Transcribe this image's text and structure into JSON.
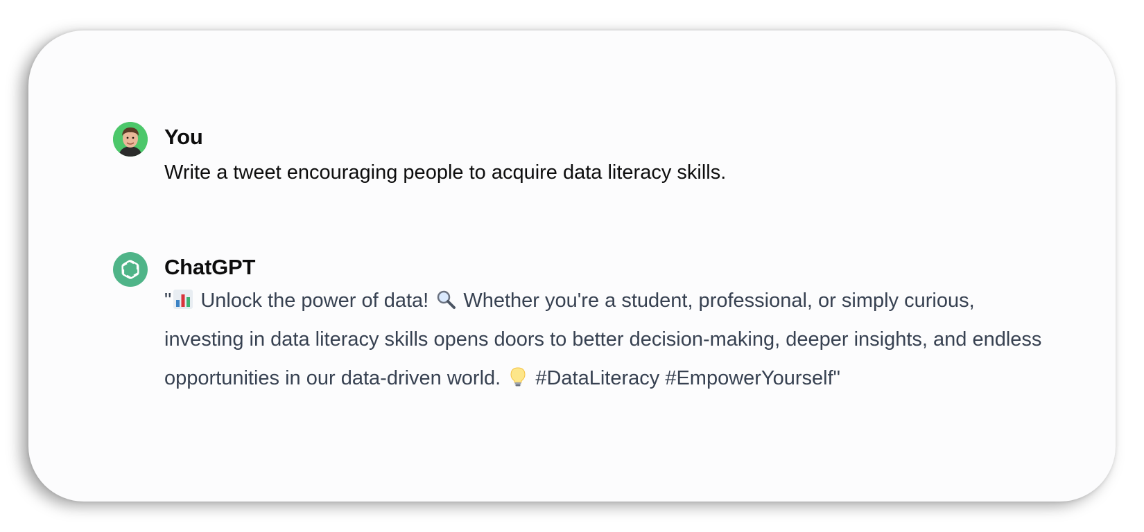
{
  "conversation": {
    "user": {
      "name": "You",
      "message": "Write a tweet encouraging people to acquire data literacy skills."
    },
    "assistant": {
      "name": "ChatGPT",
      "segments": [
        "\"",
        " Unlock the power of data! ",
        " Whether you're a student, professional, or simply curious, investing in data literacy skills opens doors to better decision-making, deeper insights, and endless opportunities in our data-driven world. ",
        " #DataLiteracy #EmpowerYourself\""
      ],
      "icons": [
        "bar-chart-emoji",
        "magnifying-glass-emoji",
        "light-bulb-emoji"
      ]
    }
  },
  "colors": {
    "card_background": "#fcfcfd",
    "user_avatar_bg": "#4cc76a",
    "chatgpt_avatar_bg": "#4fb488",
    "author_text": "#0d0d0d",
    "assistant_text": "#374151"
  }
}
